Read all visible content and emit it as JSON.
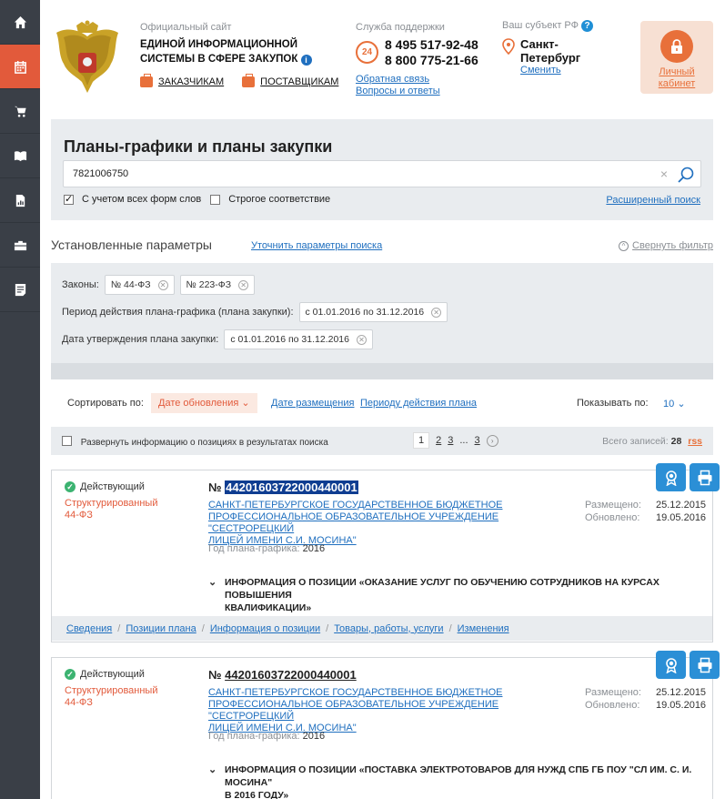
{
  "sidebar": {
    "items": [
      {
        "icon": "home-icon"
      },
      {
        "icon": "calendar-icon",
        "active": true
      },
      {
        "icon": "cart-icon"
      },
      {
        "icon": "book-icon"
      },
      {
        "icon": "report-icon"
      },
      {
        "icon": "briefcase-icon"
      },
      {
        "icon": "notes-icon"
      }
    ]
  },
  "header": {
    "site_label": "Официальный сайт",
    "site_name_line1": "ЕДИНОЙ ИНФОРМАЦИОННОЙ",
    "site_name_line2": "СИСТЕМЫ В СФЕРЕ ЗАКУПОК",
    "customers_link": "ЗАКАЗЧИКАМ",
    "suppliers_link": "ПОСТАВЩИКАМ",
    "support_label": "Служба поддержки",
    "support_badge": "24",
    "phone1": "8 495 517-92-48",
    "phone2": "8 800 775-21-66",
    "feedback_link": "Обратная связь",
    "faq_link": "Вопросы и ответы",
    "region_label": "Ваш субъект РФ",
    "region_name": "Санкт-Петербург",
    "region_change": "Сменить",
    "cabinet_line1": "Личный",
    "cabinet_line2": "кабинет"
  },
  "search": {
    "title": "Планы-графики и планы закупки",
    "query": "7821006750",
    "clear_symbol": "×",
    "check_all_forms": "С учетом всех форм слов",
    "check_strict": "Строгое соответствие",
    "advanced_link": "Расширенный поиск"
  },
  "params": {
    "title": "Установленные параметры",
    "refine_link": "Уточнить параметры поиска",
    "collapse_link": "Свернуть фильтр",
    "laws_label": "Законы:",
    "laws": [
      "№ 44-ФЗ",
      "№ 223-ФЗ"
    ],
    "period_label": "Период действия плана-графика (плана закупки):",
    "period_value": "с 01.01.2016 по 31.12.2016",
    "approval_label": "Дата утверждения плана закупки:",
    "approval_value": "с 01.01.2016 по 31.12.2016"
  },
  "sort": {
    "label": "Сортировать по:",
    "selected": "Дате обновления",
    "option2": "Дате размещения",
    "option3": "Периоду действия плана",
    "show_label": "Показывать по:",
    "show_value": "10"
  },
  "results": {
    "expand_label": "Развернуть информацию о позициях в результатах поиска",
    "pages": [
      "1",
      "2",
      "3",
      "...",
      "3"
    ],
    "total_label": "Всего записей:",
    "total_value": "28",
    "rss": "rss"
  },
  "cards": [
    {
      "status": "Действующий",
      "kind_line1": "Структурированный",
      "kind_line2": "44-ФЗ",
      "num_prefix": "№",
      "number": "44201603722000440001",
      "org_line1": "САНКТ-ПЕТЕРБУРГСКОЕ ГОСУДАРСТВЕННОЕ БЮДЖЕТНОЕ",
      "org_line2": "ПРОФЕССИОНАЛЬНОЕ ОБРАЗОВАТЕЛЬНОЕ УЧРЕЖДЕНИЕ \"СЕСТРОРЕЦКИЙ",
      "org_line3": "ЛИЦЕЙ ИМЕНИ С.И. МОСИНА\"",
      "year_label": "Год плана-графика:",
      "year": "2016",
      "placed_label": "Размещено:",
      "placed": "25.12.2015",
      "updated_label": "Обновлено:",
      "updated": "19.05.2016",
      "position_line1": "ИНФОРМАЦИЯ О ПОЗИЦИИ «ОКАЗАНИЕ УСЛУГ ПО ОБУЧЕНИЮ СОТРУДНИКОВ НА КУРСАХ ПОВЫШЕНИЯ",
      "position_line2": "КВАЛИФИКАЦИИ»",
      "tabs": [
        "Сведения",
        "Позиции плана",
        "Информация о позиции",
        "Товары, работы, услуги",
        "Изменения"
      ]
    },
    {
      "status": "Действующий",
      "kind_line1": "Структурированный",
      "kind_line2": "44-ФЗ",
      "num_prefix": "№",
      "number": "44201603722000440001",
      "org_line1": "САНКТ-ПЕТЕРБУРГСКОЕ ГОСУДАРСТВЕННОЕ БЮДЖЕТНОЕ",
      "org_line2": "ПРОФЕССИОНАЛЬНОЕ ОБРАЗОВАТЕЛЬНОЕ УЧРЕЖДЕНИЕ \"СЕСТРОРЕЦКИЙ",
      "org_line3": "ЛИЦЕЙ ИМЕНИ С.И. МОСИНА\"",
      "year_label": "Год плана-графика:",
      "year": "2016",
      "placed_label": "Размещено:",
      "placed": "25.12.2015",
      "updated_label": "Обновлено:",
      "updated": "19.05.2016",
      "position_line1": "ИНФОРМАЦИЯ О ПОЗИЦИИ «ПОСТАВКА ЭЛЕКТРОТОВАРОВ ДЛЯ НУЖД СПБ ГБ ПОУ \"СЛ ИМ. С. И. МОСИНА\"",
      "position_line2": "В 2016 ГОДУ»"
    }
  ],
  "colors": {
    "accent": "#e25a3b",
    "link": "#1f6fbf",
    "sidebar": "#3a3f47",
    "panel": "#e9ecef",
    "action_button": "#2b8fd6"
  }
}
